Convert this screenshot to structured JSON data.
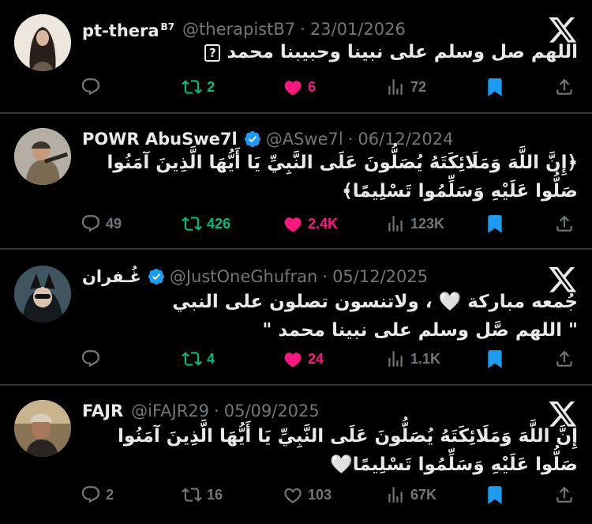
{
  "tweets": [
    {
      "name": "pt-thera",
      "name_sup": "B7",
      "verified": false,
      "handle": "@therapistB7",
      "date": "23/01/2026",
      "text": "اللهم صل وسلم على نبينا وحبيبنا محمد",
      "text_box_glyph": "?",
      "replies": "",
      "retweets": "2",
      "likes": "6",
      "views": "72",
      "liked": true,
      "retweeted": true
    },
    {
      "name": "POWR AbuSwe7l",
      "name_sup": "",
      "verified": true,
      "handle": "@ASwe7l",
      "date": "06/12/2024",
      "text": "﴿إِنَّ اللَّهَ وَمَلَائِكَتَهُ يُصَلُّونَ عَلَى النَّبِيِّ يَا أَيُّهَا الَّذِينَ آمَنُوا صَلُّوا عَلَيْهِ وَسَلِّمُوا تَسْلِيمًا﴾",
      "replies": "49",
      "retweets": "426",
      "likes": "2.4K",
      "views": "123K",
      "liked": true,
      "retweeted": true
    },
    {
      "name": "غُـفران",
      "name_sup": "",
      "verified": true,
      "handle": "@JustOneGhufran",
      "date": "05/12/2025",
      "text_line1": "جُمعه مباركة 🤍 ، ولاتنسون تصلون على النبي",
      "text_line2": "\" اللهم صَّل وسلم على نبينا محمد \"",
      "replies": "",
      "retweets": "4",
      "likes": "24",
      "views": "1.1K",
      "liked": true,
      "retweeted": true
    },
    {
      "name": "FAJR",
      "name_sup": "",
      "verified": false,
      "handle": "@iFAJR29",
      "date": "05/09/2025",
      "text": "إِنَّ اللَّهَ وَمَلَائِكَتَهُ يُصَلُّونَ عَلَى النَّبِيِّ يَا أَيُّهَا الَّذِينَ آمَنُوا صَلُّوا عَلَيْهِ وَسَلِّمُوا تَسْلِيمًا🤍",
      "replies": "2",
      "retweets": "16",
      "likes": "103",
      "views": "67K",
      "liked": false,
      "retweeted": false
    }
  ],
  "separator": "·",
  "icons": [
    "reply-icon",
    "retweet-icon",
    "like-icon",
    "views-icon",
    "bookmark-icon",
    "share-icon",
    "x-logo-icon",
    "verified-badge-icon"
  ],
  "colors": {
    "background": "#000000",
    "text": "#e7e9ea",
    "muted": "#71767b",
    "retweet_green": "#00ba7c",
    "like_pink": "#f91880",
    "bookmark_blue": "#1d9bf0",
    "divider": "#2f3336"
  }
}
